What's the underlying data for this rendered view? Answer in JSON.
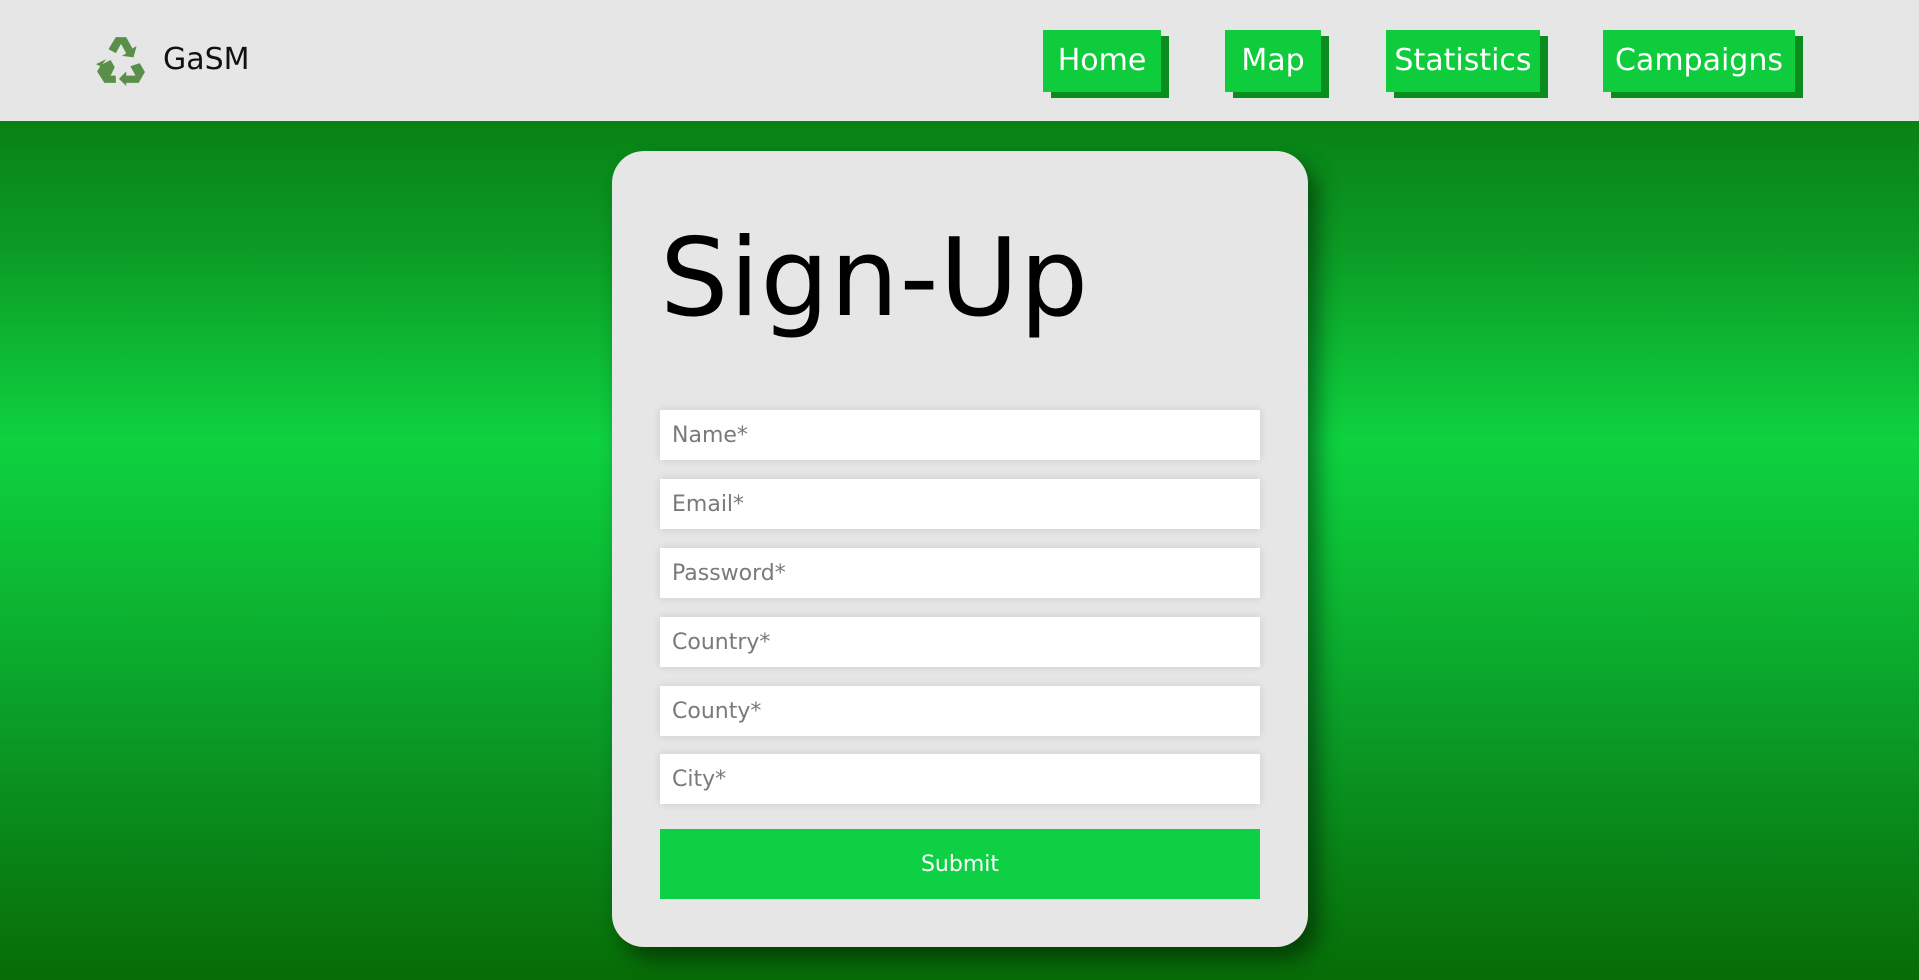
{
  "header": {
    "brand": "GaSM",
    "logo_icon": "recycle-icon",
    "nav": [
      {
        "label": "Home"
      },
      {
        "label": "Map"
      },
      {
        "label": "Statistics"
      },
      {
        "label": "Campaigns"
      }
    ]
  },
  "form": {
    "title": "Sign-Up",
    "fields": [
      {
        "placeholder": "Name*",
        "value": ""
      },
      {
        "placeholder": "Email*",
        "value": ""
      },
      {
        "placeholder": "Password*",
        "value": ""
      },
      {
        "placeholder": "Country*",
        "value": ""
      },
      {
        "placeholder": "County*",
        "value": ""
      },
      {
        "placeholder": "City*",
        "value": ""
      }
    ],
    "submit_label": "Submit"
  },
  "colors": {
    "accent_green": "#0ecc3c",
    "header_bg": "#e6e6e6",
    "card_bg": "#e6e6e6"
  }
}
